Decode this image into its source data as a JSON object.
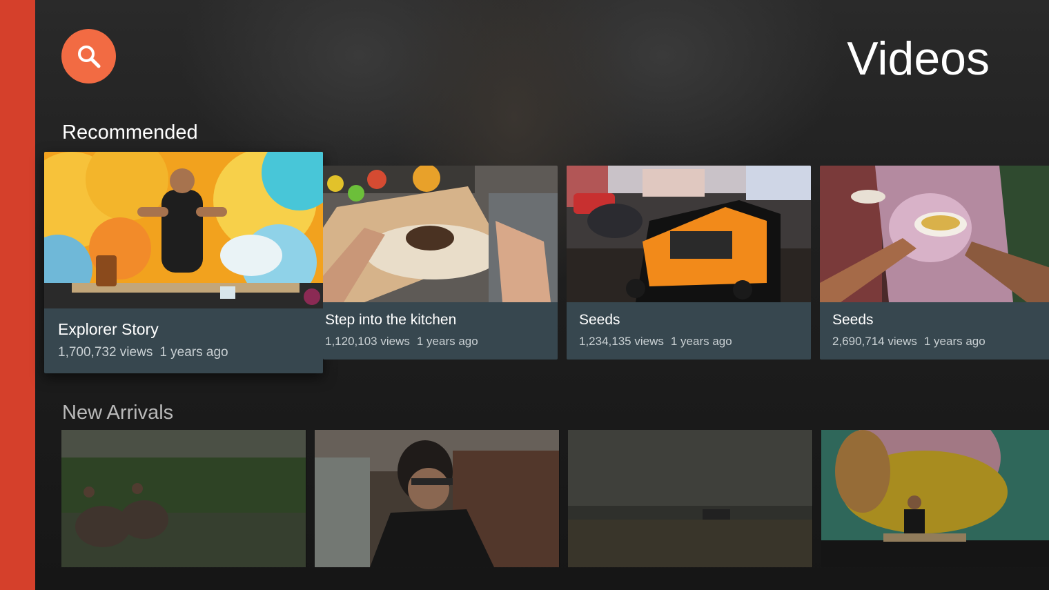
{
  "header": {
    "title": "Videos",
    "search_icon": "search-icon",
    "accent_color": "#f26b43",
    "rail_color": "#d5402b"
  },
  "rows": [
    {
      "header": "Recommended",
      "cards": [
        {
          "title": "Explorer Story",
          "views": "1,700,732 views",
          "age": "1 years ago",
          "focused": true
        },
        {
          "title": "Step into the kitchen",
          "views": "1,120,103 views",
          "age": "1 years ago"
        },
        {
          "title": "Seeds",
          "views": "1,234,135 views",
          "age": "1 years ago"
        },
        {
          "title": "Seeds",
          "views": "2,690,714 views",
          "age": "1 years ago"
        }
      ]
    },
    {
      "header": "New Arrivals",
      "cards": [
        {
          "thumb": "elephants-in-marsh"
        },
        {
          "thumb": "woman-with-glass"
        },
        {
          "thumb": "misty-field"
        },
        {
          "thumb": "chef-colorful-stage"
        }
      ]
    }
  ],
  "card_bg_color": "#37474f"
}
